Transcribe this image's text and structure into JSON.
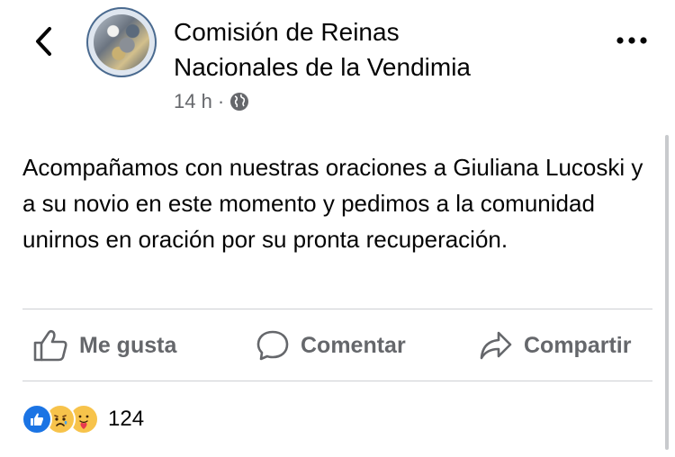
{
  "header": {
    "back_icon": "chevron-left-icon",
    "page_name_line1": "Comisión de Reinas",
    "page_name_line2": "Nacionales de la Vendimia",
    "time": "14 h",
    "separator": "·",
    "privacy_icon": "globe-icon",
    "more_icon": "more-dots-icon"
  },
  "post": {
    "text": "Acompañamos con nuestras oraciones a Giuliana Lucoski y a su novio en este momento y pedimos a la comunidad unirnos en oración por su pronta recuperación."
  },
  "actions": {
    "like_label": "Me gusta",
    "comment_label": "Comentar",
    "share_label": "Compartir"
  },
  "reactions": {
    "icons": [
      "like-reaction-icon",
      "sad-reaction-icon",
      "care-reaction-icon"
    ],
    "count": "124"
  },
  "colors": {
    "text": "#050505",
    "secondary": "#65676b",
    "divider": "#ced0d4",
    "like_blue": "#1b74e4",
    "reaction_yellow": "#f7c34b"
  }
}
